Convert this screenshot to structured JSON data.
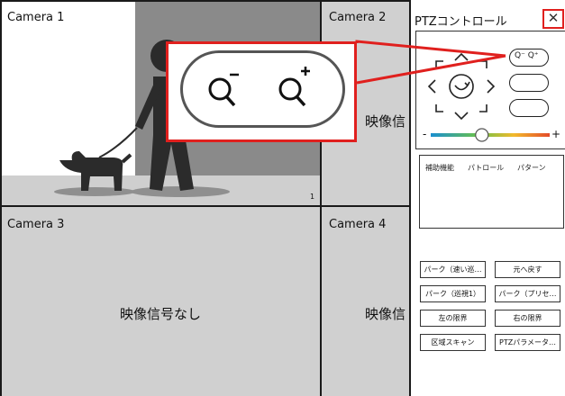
{
  "cameras": [
    {
      "label": "Camera 1",
      "channel": "1"
    },
    {
      "label": "Camera 2",
      "no_video": "映像信"
    },
    {
      "label": "Camera 3",
      "no_video": "映像信号なし"
    },
    {
      "label": "Camera 4",
      "no_video": "映像信"
    }
  ],
  "ptz": {
    "title": "PTZコントロール",
    "close": "✕",
    "zoom_out_glyph": "Q⁻",
    "zoom_in_glyph": "Q⁺",
    "zoom_pill_text": "Q⁻ Q⁺",
    "slider_minus": "-",
    "slider_plus": "+",
    "slider_fraction": 0.43,
    "tabs": [
      "補助機能",
      "パトロール",
      "パターン"
    ],
    "buttons": [
      [
        "パーク（速い巡…",
        "元へ戻す"
      ],
      [
        "パーク（巡視1）",
        "パーク（プリセ…"
      ],
      [
        "左の限界",
        "右の限界"
      ],
      [
        "区域スキャン",
        "PTZパラメータ…"
      ]
    ]
  },
  "colors": {
    "accent_red": "#e0201e",
    "slider_blue": "#1a8fd0",
    "slider_green": "#6ac24a",
    "slider_yellow": "#f2b92b",
    "slider_red": "#e44b2a"
  }
}
